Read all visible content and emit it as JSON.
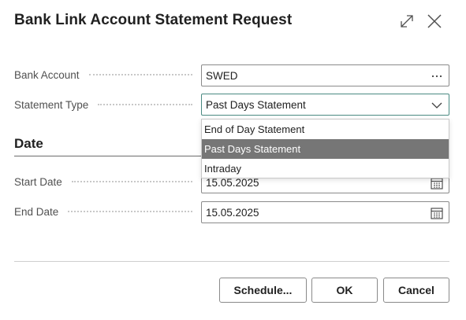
{
  "dialog": {
    "title": "Bank Link Account Statement Request"
  },
  "fields": {
    "bank_account": {
      "label": "Bank Account",
      "value": "SWED",
      "icon": "ellipsis-icon"
    },
    "statement_type": {
      "label": "Statement Type",
      "value": "Past Days Statement",
      "icon": "chevron-down-icon"
    }
  },
  "date_section": {
    "title": "Date",
    "start_date": {
      "label": "Start Date",
      "value": "15.05.2025",
      "icon": "calendar-icon"
    },
    "end_date": {
      "label": "End Date",
      "value": "15.05.2025",
      "icon": "calendar-icon"
    }
  },
  "dropdown": {
    "options": [
      "End of Day Statement",
      "Past Days Statement",
      "Intraday"
    ],
    "selected": "Past Days Statement"
  },
  "buttons": {
    "schedule": "Schedule...",
    "ok": "OK",
    "cancel": "Cancel"
  },
  "colors": {
    "focus_border": "#4a8a82",
    "selected_option_bg": "#767676"
  }
}
